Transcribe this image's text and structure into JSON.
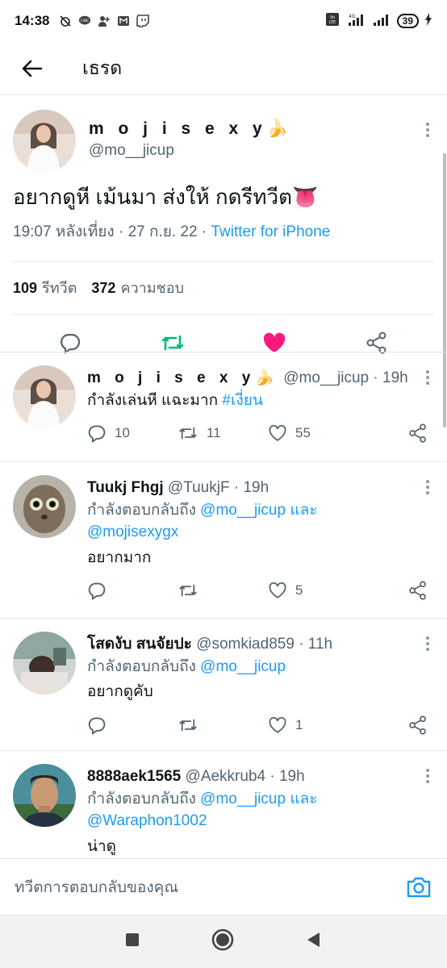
{
  "status_bar": {
    "time": "14:38",
    "battery": "39",
    "icons": [
      "alarm-off-icon",
      "line-icon",
      "person-add-icon",
      "gmail-icon",
      "twitch-icon",
      "volte-icon",
      "signal-4g-icon",
      "signal-icon",
      "charging-icon"
    ]
  },
  "header": {
    "title": "เธรด"
  },
  "main_tweet": {
    "display_name": "m o j i s e x y🍌",
    "handle": "@mo__jicup",
    "text": "อยากดูหี เม้นมา ส่งให้ กดรีทวีต👅",
    "time": "19:07 หลังเที่ยง · 27 ก.ย. 22 · ",
    "source": "Twitter for iPhone",
    "retweets_count": "109",
    "retweets_label": "รีทวีต",
    "likes_count": "372",
    "likes_label": "ความชอบ",
    "liked_color": "#f91880",
    "retweet_color": "#00ba7c"
  },
  "replies": [
    {
      "name": "m o j i s e x y🍌",
      "handle": "@mo__jicup",
      "time": "· 19h",
      "text_prefix": "กำลังเล่นหี แฉะมาก ",
      "hashtag": "#เงี่ยน",
      "reply_count": "10",
      "retweet_count": "11",
      "like_count": "55"
    },
    {
      "name": "Tuukj Fhgj",
      "handle": "@TuukjF",
      "time": "· 19h",
      "replying_prefix": "กำลังตอบกลับถึง ",
      "mention1": "@mo__jicup",
      "and_word": " และ",
      "mention2": "@mojisexygx",
      "text": "อยากมาก",
      "like_count": "5"
    },
    {
      "name": "โสดงับ สนจัยปะ",
      "handle": "@somkiad859",
      "time": "· 11h",
      "replying_prefix": "กำลังตอบกลับถึง ",
      "mention1": "@mo__jicup",
      "text": "อยากดูคับ",
      "like_count": "1"
    },
    {
      "name": "8888aek1565",
      "handle": "@Aekkrub4",
      "time": "· 19h",
      "replying_prefix": "กำลังตอบกลับถึง ",
      "mention1": "@mo__jicup",
      "and_word": " และ",
      "mention2": "@Waraphon1002",
      "text": "น่าดู"
    }
  ],
  "compose": {
    "placeholder": "ทวีตการตอบกลับของคุณ"
  },
  "accent_color": "#1d9bf0"
}
